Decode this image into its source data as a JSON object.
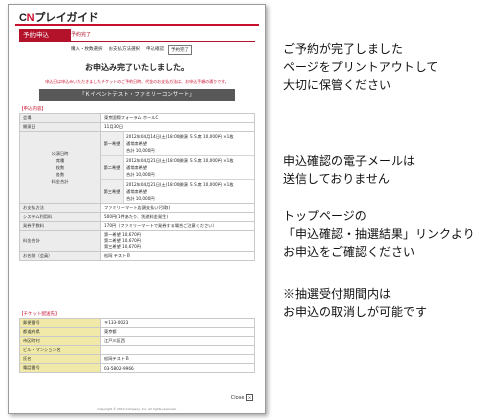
{
  "page": {
    "logo": {
      "prefix": "C",
      "accent": "N",
      "rest": "プレイガイド"
    },
    "title": "予約申込",
    "title_sub": "予約完了",
    "steps": [
      "購入・枚数選択",
      "お支払方法選択",
      "申込確認",
      "予約完了"
    ],
    "thanks": "お申込み完了いたしました。",
    "note": "申込日は申込みいただきましたチケットのご予約日時、代金のお支払方法は、お申込手順の通りです。",
    "concert_title": "「Ｋイベントテスト・ファミリーコンサート」",
    "sec_apply": "【申込内容】",
    "apply_rows": [
      {
        "label": "会場",
        "value": "東京国際フォーラム ホールC"
      },
      {
        "label": "開演日",
        "value": "11月30日"
      }
    ],
    "wish_label_lines": [
      "公演日時",
      "席種",
      "枚数",
      "各数",
      "料金合計"
    ],
    "wishes": [
      {
        "label": "第一希望",
        "l1": "2012年04月14日(土)18:00開演 ＳＳ席 10,000円 ×1枚",
        "l2": "通常席希望",
        "l3": "合計 10,000円"
      },
      {
        "label": "第二希望",
        "l1": "2012年04月21日(土)18:00開演 ＳＳ席 10,000円 ×1枚",
        "l2": "通常席希望",
        "l3": "合計 10,000円"
      },
      {
        "label": "第三希望",
        "l1": "2012年04月21日(土)18:00開演 ＳＳ席 10,000円 ×1枚",
        "l2": "通常席希望",
        "l3": "合計 10,000円"
      }
    ],
    "apply_rows2": [
      {
        "label": "お支払方法",
        "value": "ファミリーマート店頭支払い(引取)"
      },
      {
        "label": "システム利用料",
        "value": "500円(1件あたり、別途料金発生)"
      },
      {
        "label": "発券手数料",
        "value": "170円（ファミリーマートで発券する場合ご注意ください）"
      }
    ],
    "total": {
      "label": "料金合計",
      "lines": [
        "第一希望 10,670円",
        "第二希望 10,670円",
        "第三希望 10,670円"
      ]
    },
    "applicant": {
      "label": "お名前（会員）",
      "value": "松岡 テストＢ"
    },
    "sec_ticket": "【チケット配送先】",
    "ticket_rows": [
      {
        "label": "郵便番号",
        "value": "〒133-0023"
      },
      {
        "label": "都道府県",
        "value": "東京都"
      },
      {
        "label": "市区町村",
        "value": "江戸川区西"
      },
      {
        "label": "ビル・マンション名",
        "value": ""
      },
      {
        "label": "氏名",
        "value": "松岡テストＢ"
      },
      {
        "label": "電話番号",
        "value": "03-5802-9966"
      }
    ],
    "close": "Close",
    "footer": "Copyright © 2012 Company, Inc. All rights reserved."
  },
  "side": {
    "block1": [
      "ご予約が完了しました",
      "ページをプリントアウトして",
      "大切に保管ください"
    ],
    "block2": [
      "申込確認の電子メールは",
      "送信しておりません"
    ],
    "block3": [
      "トップページの",
      "「申込確認・抽選結果」リンクより",
      "お申込をご確認ください"
    ],
    "block4": [
      "※抽選受付期間内は",
      "お申込の取消しが可能です"
    ]
  },
  "colors": {
    "accent": "#c8102e",
    "header_dark": "#585858",
    "label_gray": "#ececec",
    "label_yellow": "#f1e9a8"
  }
}
